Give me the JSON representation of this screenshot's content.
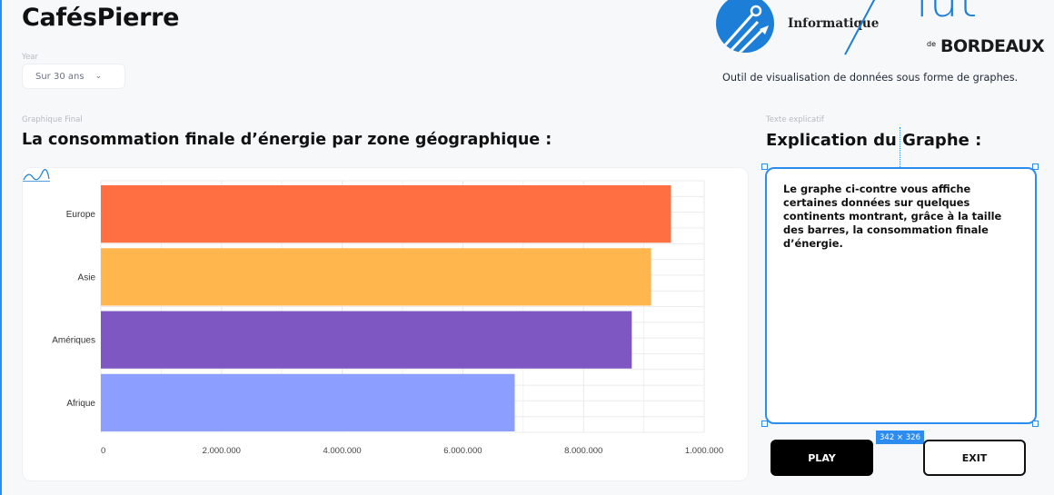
{
  "app": {
    "title": "CafésPierre"
  },
  "filters": {
    "year_label": "Year",
    "year_value": "Sur 30 ans"
  },
  "branding": {
    "dept": "Informatique",
    "iut": "iut",
    "de": "de",
    "city": "BORDEAUX",
    "tagline": "Outil de visualisation de données sous forme de graphes."
  },
  "graph": {
    "section_label": "Graphique Final",
    "title": "La consommation finale d’énergie  par zone géographique :"
  },
  "explanation": {
    "section_label": "Texte explicatif",
    "title": "Explication du Graphe :",
    "text": "Le graphe ci-contre vous affiche certaines données sur quelques continents montrant, grâce à la taille des barres, la consommation finale d’énergie.",
    "size_badge": "342 × 326"
  },
  "buttons": {
    "play": "PLAY",
    "exit": "EXIT"
  },
  "colors": {
    "accent": "#2d8cf0",
    "brand_blue": "#1c7ed6"
  },
  "chart_data": {
    "type": "bar",
    "orientation": "horizontal",
    "categories": [
      "Europe",
      "Asie",
      "Amériques",
      "Afrique"
    ],
    "values": [
      9450000,
      9120000,
      8800000,
      6860000
    ],
    "colors": [
      "#ff6f41",
      "#ffb64d",
      "#7e57c2",
      "#8c9eff"
    ],
    "xlim": [
      0,
      10000000
    ],
    "xticks": [
      0,
      2000000,
      4000000,
      6000000,
      8000000,
      10000000
    ],
    "xtick_labels": [
      "0",
      "2.000.000",
      "4.000.000",
      "6.000.000",
      "8.000.000",
      "1.000.000"
    ],
    "grid": true
  }
}
